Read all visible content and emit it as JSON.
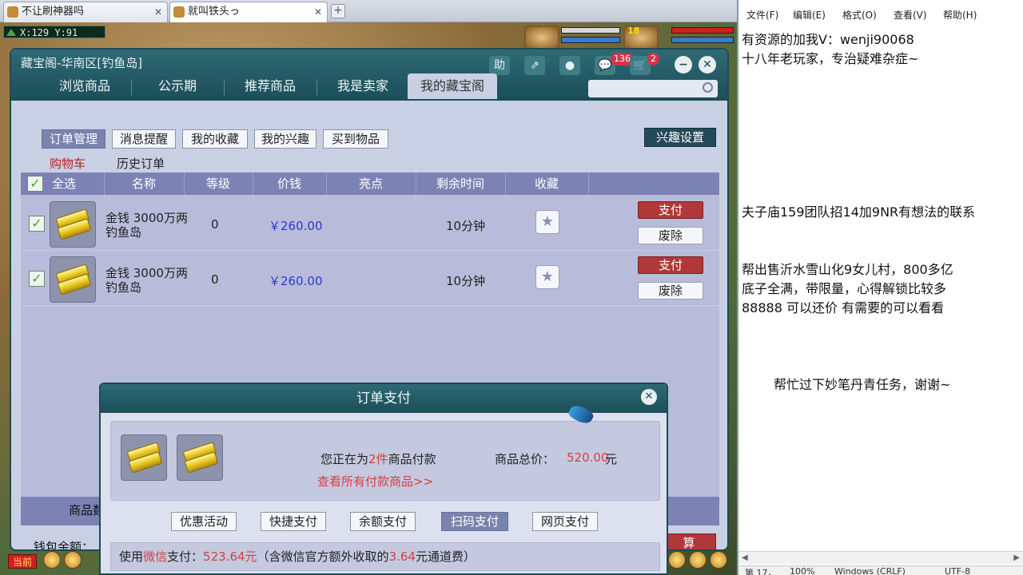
{
  "browser": {
    "tabs": [
      {
        "title": "不让刷神器吗",
        "close": "✕"
      },
      {
        "title": "就叫铁头っ",
        "close": "✕"
      }
    ],
    "new_tab": "+"
  },
  "game": {
    "coords": "X:129 Y:91",
    "level": "18"
  },
  "cbg": {
    "title": "藏宝阁-华南区[钓鱼岛]",
    "header_buttons": {
      "help": "助",
      "share": "⇗",
      "record": "●",
      "chat": "💬",
      "cart": "🛒",
      "minimize": "−",
      "close": "✕"
    },
    "chat_count": "136",
    "cart_count": "2",
    "main_tabs": [
      "浏览商品",
      "公示期",
      "推荐商品",
      "我是卖家",
      "我的藏宝阁"
    ],
    "sub_tabs": [
      "订单管理",
      "消息提醒",
      "我的收藏",
      "我的兴趣",
      "买到物品"
    ],
    "interest_settings": "兴趣设置",
    "sub_links": {
      "cart": "购物车",
      "history": "历史订单"
    },
    "columns": [
      "全选",
      "名称",
      "等级",
      "价钱",
      "亮点",
      "剩余时间",
      "收藏"
    ],
    "check_mark": "✓",
    "star": "★",
    "rows": [
      {
        "name_line1": "金钱 3000万两",
        "name_line2": "钓鱼岛",
        "level": "0",
        "price": "￥260.00",
        "remaining": "10分钟",
        "pay": "支付",
        "delete": "废除"
      },
      {
        "name_line1": "金钱 3000万两",
        "name_line2": "钓鱼岛",
        "level": "0",
        "price": "￥260.00",
        "remaining": "10分钟",
        "pay": "支付",
        "delete": "废除"
      }
    ],
    "footer_label": "商品数",
    "wallet_label": "钱包余额：",
    "settle": "算"
  },
  "pay_modal": {
    "title": "订单支付",
    "close": "✕",
    "paying_prefix": "您正在为",
    "paying_count": "2件",
    "paying_suffix": "商品付款",
    "view_all": "查看所有付款商品>>",
    "total_label": "商品总价：",
    "total_value": "520.00",
    "total_unit": "元",
    "methods": [
      "优惠活动",
      "快捷支付",
      "余额支付",
      "扫码支付",
      "网页支付"
    ],
    "active_method_index": 3,
    "summary": {
      "prefix": "使用",
      "method": "微信",
      "mid": "支付：",
      "amount": "523.64元",
      "note_prefix": "（含微信官方额外收取的",
      "fee": "3.64",
      "note_suffix": "元通道费）"
    }
  },
  "hud": {
    "now": "当前"
  },
  "notepad": {
    "menu": [
      "文件(F)",
      "编辑(E)",
      "格式(O)",
      "查看(V)",
      "帮助(H)"
    ],
    "lines": [
      "有资源的加我V：wenji90068",
      "十八年老玩家，专治疑难杂症~",
      "夫子庙159团队招14加9NR有想法的联系",
      "帮出售沂水雪山化9女儿村，800多亿",
      "底子全满，带限量，心得解锁比较多",
      "88888 可以还价 有需要的可以看看",
      "帮忙过下妙笔丹青任务，谢谢~"
    ],
    "status": [
      "第 17，",
      "100%",
      "Windows (CRLF)",
      "UTF-8"
    ],
    "scroll_left": "◀",
    "scroll_right": "▶"
  }
}
